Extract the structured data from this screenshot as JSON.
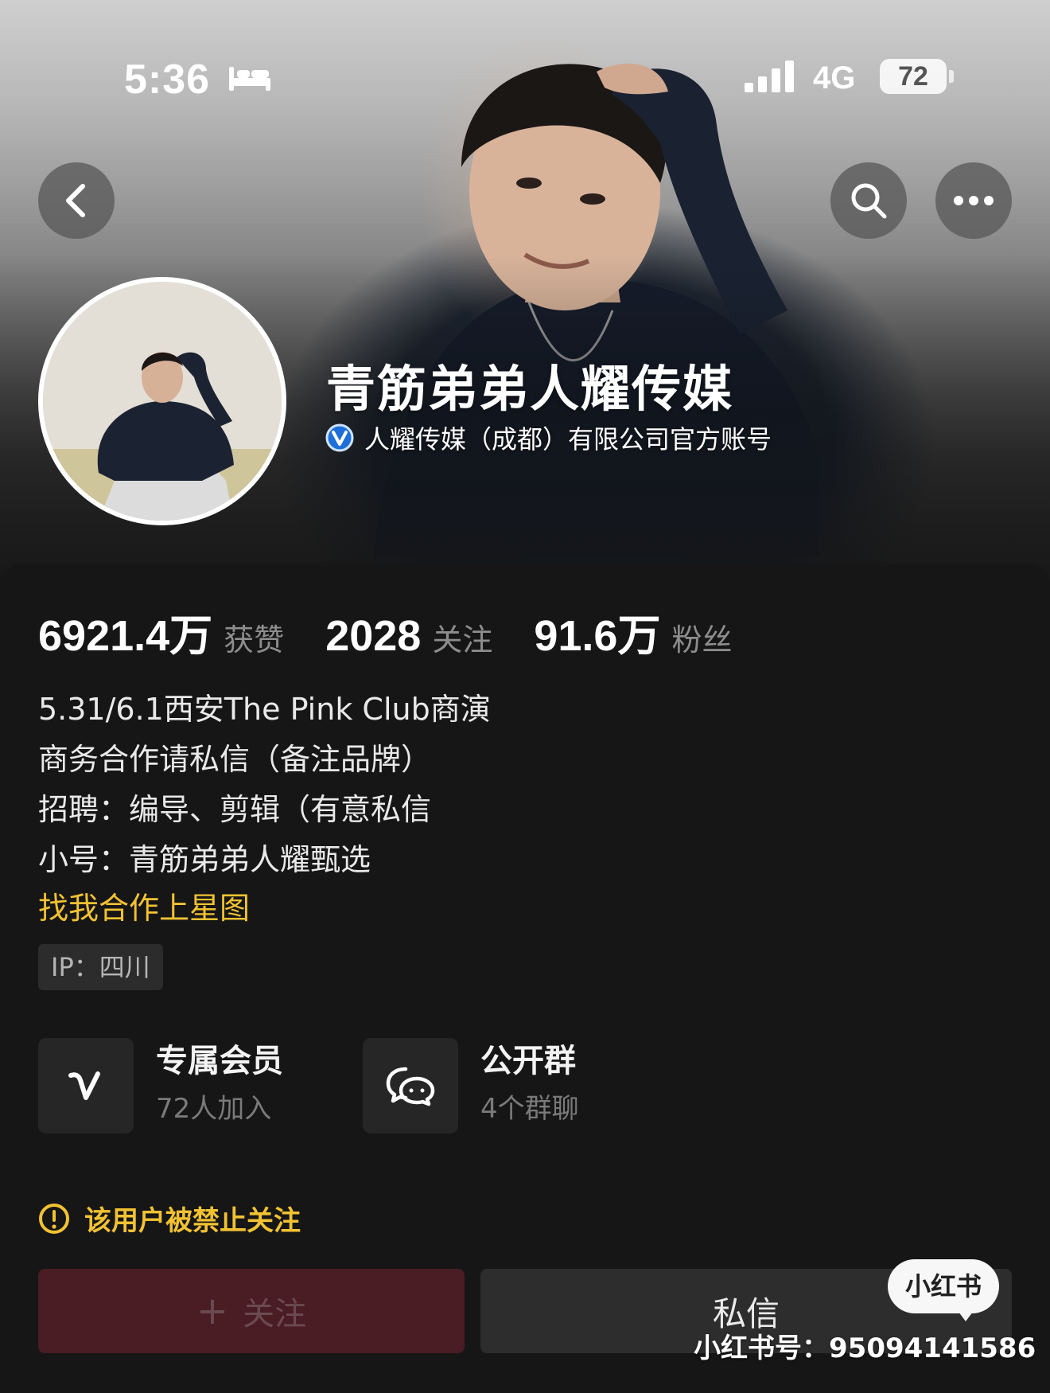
{
  "status_bar": {
    "time": "5:36",
    "network": "4G",
    "battery": "72"
  },
  "profile": {
    "name": "青筋弟弟人耀传媒",
    "verification": "人耀传媒（成都）有限公司官方账号"
  },
  "stats": [
    {
      "value": "6921.4万",
      "label": "获赞"
    },
    {
      "value": "2028",
      "label": "关注"
    },
    {
      "value": "91.6万",
      "label": "粉丝"
    }
  ],
  "bio": [
    "5.31/6.1西安The Pink Club商演",
    "商务合作请私信（备注品牌）",
    "招聘：编导、剪辑（有意私信",
    "小号：青筋弟弟人耀甄选"
  ],
  "star_link": "找我合作上星图",
  "ip_tag": "IP：四川",
  "features": {
    "membership": {
      "title": "专属会员",
      "sub": "72人加入"
    },
    "group": {
      "title": "公开群",
      "sub": "4个群聊"
    }
  },
  "warning": "该用户被禁止关注",
  "actions": {
    "follow": "关注",
    "follow_plus": "+",
    "message": "私信"
  },
  "watermark": {
    "logo": "小红书",
    "id": "小红书号：95094141586"
  },
  "colors": {
    "accent_yellow": "#f2c232",
    "follow_disabled_bg": "#4a1c24",
    "panel_bg": "#161616"
  }
}
